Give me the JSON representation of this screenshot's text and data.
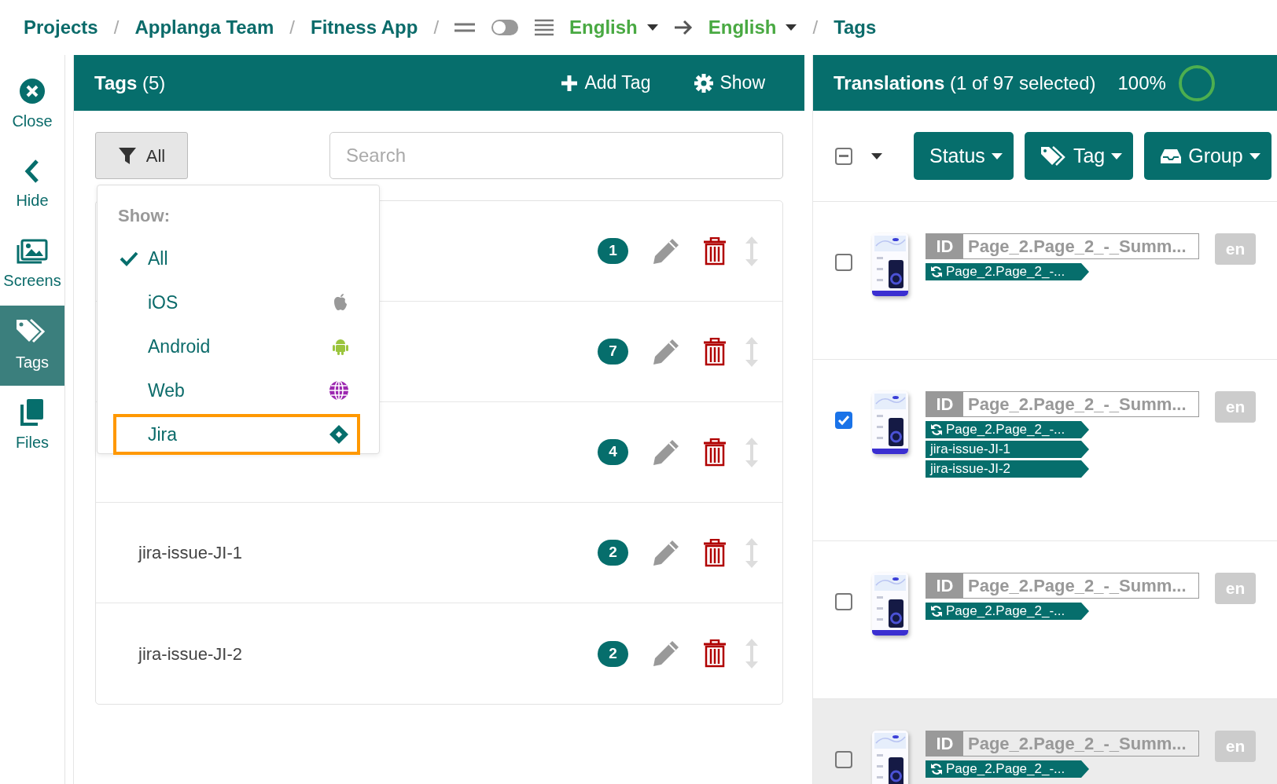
{
  "breadcrumb": {
    "separator": "/",
    "path": [
      "Projects",
      "Applanga Team",
      "Fitness App"
    ],
    "view_toggle": {
      "on": false
    },
    "source_language": "English",
    "target_language": "English",
    "current": "Tags"
  },
  "sidebar": {
    "items": [
      {
        "label": "Close",
        "kind": "close",
        "selected": false
      },
      {
        "label": "Hide",
        "kind": "hide",
        "selected": false
      },
      {
        "label": "Screens",
        "kind": "screens",
        "selected": false
      },
      {
        "label": "Tags",
        "kind": "tags",
        "selected": true
      },
      {
        "label": "Files",
        "kind": "files",
        "selected": false
      }
    ]
  },
  "tags_panel": {
    "title": "**Tags** (5)",
    "actions": [
      {
        "label": "Add Tag",
        "kind": "add"
      },
      {
        "label": "Show",
        "kind": "settings"
      }
    ],
    "filter": {
      "label": "All"
    },
    "search": {
      "placeholder": "Search"
    },
    "rows": [
      {
        "count": "1"
      },
      {
        "count": "7"
      },
      {
        "count": "4"
      },
      {
        "name": "jira-issue-JI-1",
        "count": "2"
      },
      {
        "name": "jira-issue-JI-2",
        "count": "2"
      }
    ],
    "filter_menu": {
      "header": "Show:",
      "items": [
        {
          "label": "All",
          "kind": "all",
          "checked": true,
          "highlighted": false
        },
        {
          "label": "iOS",
          "kind": "ios",
          "checked": false,
          "highlighted": false
        },
        {
          "label": "Android",
          "kind": "android",
          "checked": false,
          "highlighted": false
        },
        {
          "label": "Web",
          "kind": "web",
          "checked": false,
          "highlighted": false
        },
        {
          "label": "Jira",
          "kind": "jira",
          "checked": false,
          "highlighted": true
        }
      ]
    }
  },
  "translations_panel": {
    "title": "**Translations** (1 of 97 selected)",
    "progress": {
      "reading": "100%",
      "level": 1
    },
    "select_all": {
      "indeterminate": true
    },
    "filters": [
      {
        "label": "Status",
        "kind": "status"
      },
      {
        "label": "Tag",
        "kind": "tag"
      },
      {
        "label": "Group",
        "kind": "group"
      }
    ],
    "rows": [
      {
        "checked": false,
        "highlighted": false,
        "id_label": "ID",
        "key": "Page_2.Page_2_-_Summ...",
        "language": "en",
        "tags": [
          {
            "label": "Page_2.Page_2_-...",
            "kind": "sync"
          }
        ]
      },
      {
        "checked": true,
        "highlighted": false,
        "id_label": "ID",
        "key": "Page_2.Page_2_-_Summ...",
        "language": "en",
        "tags": [
          {
            "label": "Page_2.Page_2_-...",
            "kind": "sync"
          },
          {
            "label": "jira-issue-JI-1",
            "kind": "plain"
          },
          {
            "label": "jira-issue-JI-2",
            "kind": "plain"
          }
        ]
      },
      {
        "checked": false,
        "highlighted": false,
        "id_label": "ID",
        "key": "Page_2.Page_2_-_Summ...",
        "language": "en",
        "tags": [
          {
            "label": "Page_2.Page_2_-...",
            "kind": "sync"
          }
        ]
      },
      {
        "checked": false,
        "highlighted": true,
        "id_label": "ID",
        "key": "Page_2.Page_2_-_Summ...",
        "language": "en",
        "tags": [
          {
            "label": "Page_2.Page_2_-...",
            "kind": "sync"
          }
        ]
      }
    ]
  }
}
